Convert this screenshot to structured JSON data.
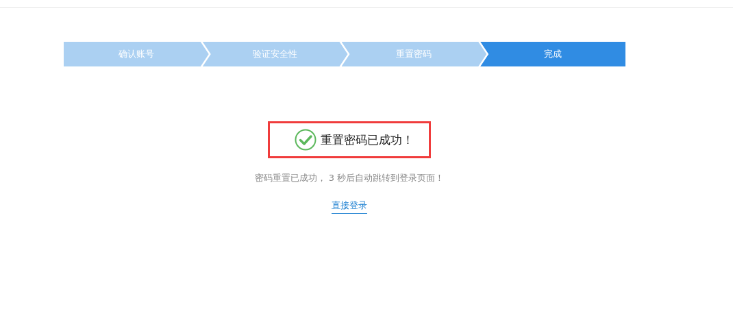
{
  "steps": [
    {
      "label": "确认账号",
      "selected": false
    },
    {
      "label": "验证安全性",
      "selected": false
    },
    {
      "label": "重置密码",
      "selected": false
    },
    {
      "label": "完成",
      "selected": true
    }
  ],
  "result": {
    "title": "重置密码已成功！",
    "highlighted": true
  },
  "message": "密码重置已成功， 3 秒后自动跳转到登录页面！",
  "link": "直接登录"
}
